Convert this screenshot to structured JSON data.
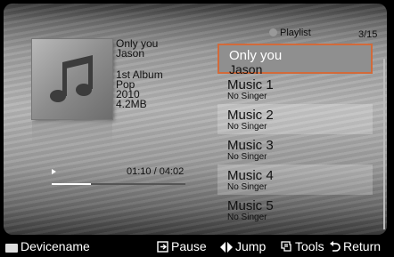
{
  "track": {
    "title": "Only you",
    "artist": "Jason",
    "album": "1st Album",
    "genre": "Pop",
    "year": "2010",
    "size": "4.2MB"
  },
  "playback": {
    "time": "01:10 / 04:02",
    "progress_fraction": 0.29
  },
  "playlist": {
    "label": "Playlist",
    "counter": "3/15",
    "items": [
      {
        "title": "Only you",
        "subtitle": "Jason",
        "selected": true
      },
      {
        "title": "Music 1",
        "subtitle": "No Singer"
      },
      {
        "title": "Music 2",
        "subtitle": "No Singer"
      },
      {
        "title": "Music 3",
        "subtitle": "No Singer"
      },
      {
        "title": "Music 4",
        "subtitle": "No Singer"
      },
      {
        "title": "Music 5",
        "subtitle": "No Singer"
      }
    ]
  },
  "footer": {
    "device": "Devicename",
    "pause": "Pause",
    "jump": "Jump",
    "tools": "Tools",
    "return": "Return"
  },
  "colors": {
    "selection_border": "#d26a3a",
    "selection_fill": "#8f8f8f"
  },
  "icons": [
    "music-note-icon",
    "play-icon",
    "playlist-icon",
    "enter-icon",
    "left-right-arrows-icon",
    "tools-icon",
    "return-icon",
    "device-icon"
  ]
}
